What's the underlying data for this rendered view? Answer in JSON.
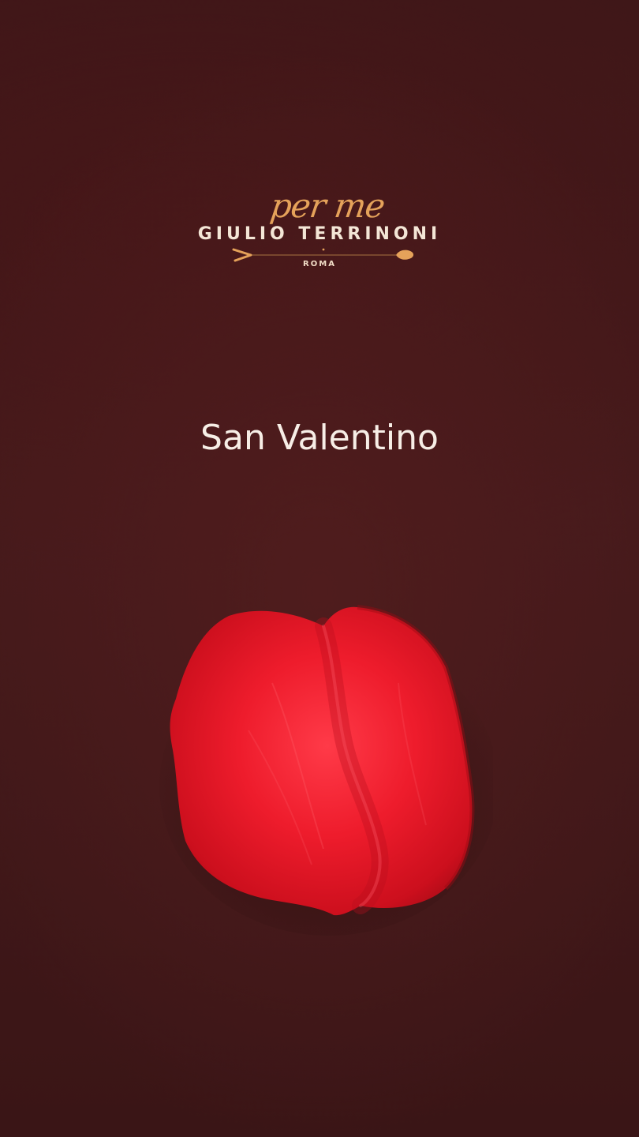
{
  "brand": {
    "script": "per me",
    "name": "GIULIO TERRINONI",
    "city": "ROMA",
    "accent_color": "#e5a25a"
  },
  "headline": "San Valentino",
  "background_color": "#441a1b",
  "hero_image": "rose-petal"
}
